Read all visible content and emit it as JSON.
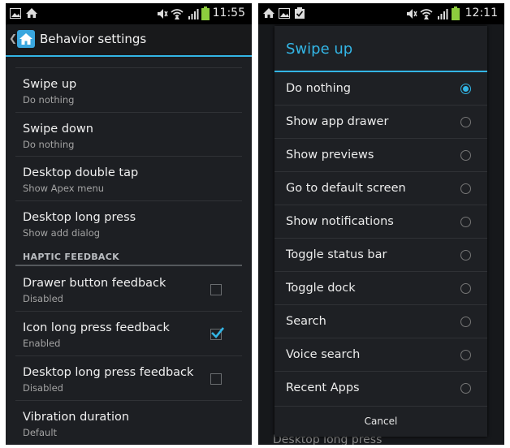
{
  "left": {
    "status": {
      "time": "11:55"
    },
    "title": "Behavior settings",
    "rows": [
      {
        "title": "Swipe up",
        "summary": "Do nothing"
      },
      {
        "title": "Swipe down",
        "summary": "Do nothing"
      },
      {
        "title": "Desktop double tap",
        "summary": "Show Apex menu"
      },
      {
        "title": "Desktop long press",
        "summary": "Show add dialog"
      }
    ],
    "section": "HAPTIC FEEDBACK",
    "haptic_rows": [
      {
        "title": "Drawer button feedback",
        "summary": "Disabled",
        "checked": false
      },
      {
        "title": "Icon long press feedback",
        "summary": "Enabled",
        "checked": true
      },
      {
        "title": "Desktop long press feedback",
        "summary": "Disabled",
        "checked": false
      }
    ],
    "last_row": {
      "title": "Vibration duration",
      "summary": "Default"
    }
  },
  "right": {
    "status": {
      "time": "12:11"
    },
    "dialog_title": "Swipe up",
    "options": [
      {
        "label": "Do nothing",
        "selected": true
      },
      {
        "label": "Show app drawer",
        "selected": false
      },
      {
        "label": "Show previews",
        "selected": false
      },
      {
        "label": "Go to default screen",
        "selected": false
      },
      {
        "label": "Show notifications",
        "selected": false
      },
      {
        "label": "Toggle status bar",
        "selected": false
      },
      {
        "label": "Toggle dock",
        "selected": false
      },
      {
        "label": "Search",
        "selected": false
      },
      {
        "label": "Voice search",
        "selected": false
      },
      {
        "label": "Recent Apps",
        "selected": false
      }
    ],
    "cancel_label": "Cancel",
    "behind_text": "Desktop long press"
  },
  "colors": {
    "accent": "#33b5e5",
    "background": "#1d1f23",
    "text_primary": "#f0f0f0",
    "text_secondary": "#a3a3a3"
  },
  "icons": [
    "image-icon",
    "home-icon",
    "mute-icon",
    "wifi-icon",
    "signal-icon",
    "battery-icon",
    "clipboard-icon",
    "back-caret-icon",
    "apex-home-icon",
    "checkbox-icon",
    "radio-icon"
  ]
}
